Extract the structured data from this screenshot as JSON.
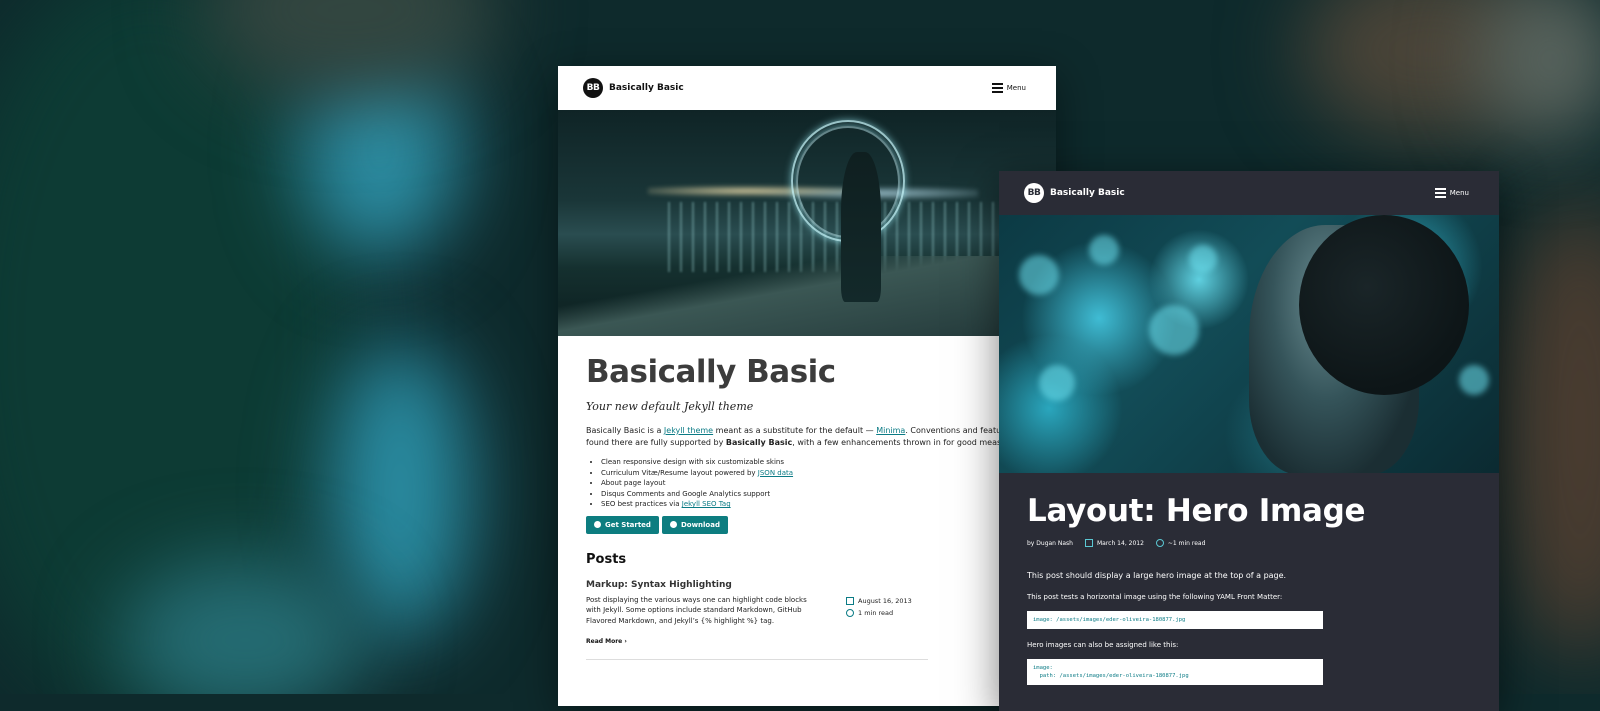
{
  "light_card": {
    "brand": {
      "logo_text": "BB",
      "name": "Basically Basic"
    },
    "menu_label": "Menu",
    "title": "Basically Basic",
    "subtitle": "Your new default Jekyll theme",
    "intro": {
      "p1": "Basically Basic is a ",
      "link1": "Jekyll theme",
      "p2": " meant as a substitute for the default — ",
      "link2": "Minima",
      "p3": ". Conventions and features found there are fully supported by ",
      "bold": "Basically Basic",
      "p4": ", with a few enhancements thrown in for good measure:"
    },
    "features": [
      {
        "text": "Clean responsive design with six customizable skins"
      },
      {
        "text": "Curriculum Vitæ/Resume layout powered by ",
        "link": "JSON data"
      },
      {
        "text": "About page layout"
      },
      {
        "text": "Disqus Comments and Google Analytics support"
      },
      {
        "text": "SEO best practices via ",
        "link": "Jekyll SEO Tag"
      }
    ],
    "buttons": {
      "get_started": "Get Started",
      "download": "Download"
    },
    "posts_heading": "Posts",
    "post": {
      "title": "Markup: Syntax Highlighting",
      "excerpt": "Post displaying the various ways one can highlight code blocks with Jekyll. Some options include standard Markdown, GitHub Flavored Markdown, and Jekyll’s {% highlight %} tag.",
      "date": "August 16, 2013",
      "read_time": "1 min read",
      "read_more": "Read More"
    }
  },
  "dark_card": {
    "brand": {
      "logo_text": "BB",
      "name": "Basically Basic"
    },
    "menu_label": "Menu",
    "title": "Layout: Hero Image",
    "byline": {
      "author": "by Dugan Nash",
      "date": "March 14, 2012",
      "read_time": "~1 min read"
    },
    "p1": "This post should display a large hero image at the top of a page.",
    "p2": "This post tests a horizontal image using the following YAML Front Matter:",
    "code1": "image: /assets/images/eder-oliveira-180877.jpg",
    "p3": "Hero images can also be assigned like this:",
    "code2_line1": "image:",
    "code2_line2": "  path: /assets/images/eder-oliveira-180877.jpg"
  },
  "colors": {
    "accent": "#0d7d80",
    "dark_bg": "#2a2c36",
    "backdrop": "#0e2a2c"
  }
}
